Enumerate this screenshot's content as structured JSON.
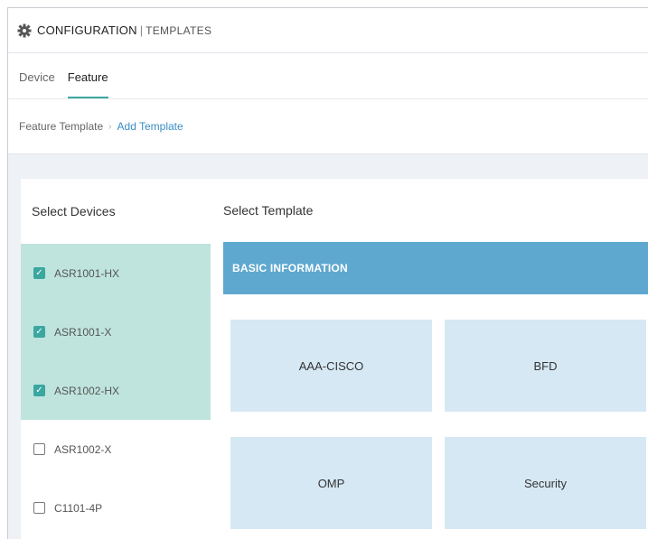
{
  "header": {
    "title": "CONFIGURATION",
    "separator": "|",
    "subtitle": "TEMPLATES",
    "icon": "gear-icon"
  },
  "tabs": [
    {
      "label": "Device",
      "active": false
    },
    {
      "label": "Feature",
      "active": true
    }
  ],
  "breadcrumb": {
    "base": "Feature Template",
    "separator": "›",
    "current": "Add Template"
  },
  "devices": {
    "title": "Select Devices",
    "items": [
      {
        "label": "ASR1001-HX",
        "checked": true
      },
      {
        "label": "ASR1001-X",
        "checked": true
      },
      {
        "label": "ASR1002-HX",
        "checked": true
      },
      {
        "label": "ASR1002-X",
        "checked": false
      },
      {
        "label": "C1101-4P",
        "checked": false
      }
    ]
  },
  "templates": {
    "title": "Select Template",
    "section": "BASIC INFORMATION",
    "tiles": [
      "AAA-CISCO",
      "BFD",
      "OMP",
      "Security"
    ]
  },
  "colors": {
    "accent": "#3aa7a0",
    "selected_row": "#bfe4dd",
    "section_bar": "#5ea8d0",
    "tile": "#d6e8f4",
    "link": "#3a8fc4"
  }
}
